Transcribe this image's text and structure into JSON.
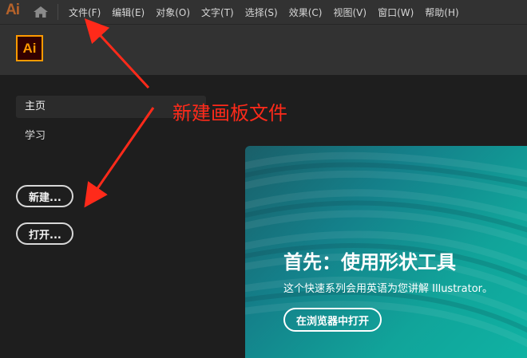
{
  "menubar": {
    "logo": "Ai",
    "home_icon": "home-icon",
    "items": [
      "文件(F)",
      "编辑(E)",
      "对象(O)",
      "文字(T)",
      "选择(S)",
      "效果(C)",
      "视图(V)",
      "窗口(W)",
      "帮助(H)"
    ]
  },
  "header": {
    "logo": "Ai"
  },
  "sidebar": {
    "items": [
      "主页",
      "学习"
    ],
    "new_button": "新建...",
    "open_button": "打开..."
  },
  "annotation": {
    "text": "新建画板文件",
    "color": "#ff2a1a"
  },
  "promo": {
    "title": "首先：使用形状工具",
    "description": "这个快速系列会用英语为您讲解 Illustrator。",
    "button": "在浏览器中打开"
  },
  "colors": {
    "accent_orange": "#ff9a00",
    "background": "#1e1e1e",
    "menubar": "#323232",
    "promo_teal": "#14808a"
  }
}
